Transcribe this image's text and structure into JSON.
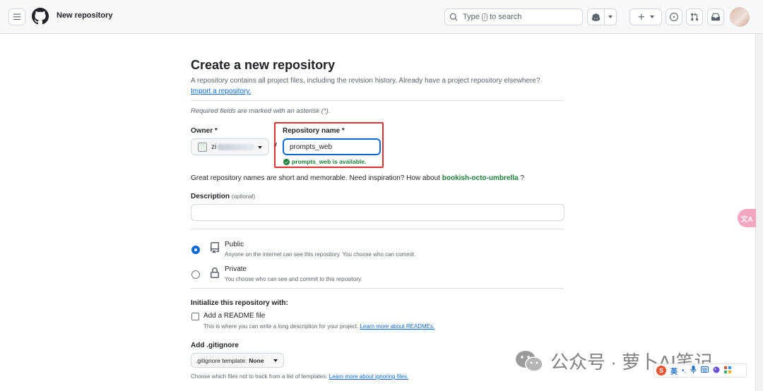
{
  "header": {
    "breadcrumb": "New repository",
    "search": {
      "prefix": "Type",
      "key": "/",
      "suffix": "to search"
    }
  },
  "page": {
    "title": "Create a new repository",
    "intro": "A repository contains all project files, including the revision history. Already have a project repository elsewhere?",
    "import_link": "Import a repository.",
    "required_note": "Required fields are marked with an asterisk (*).",
    "owner_label": "Owner *",
    "owner_value_visible": "zi",
    "separator": "/",
    "repo_name_label": "Repository name *",
    "repo_name_value": "prompts_web",
    "availability": "prompts_web is available.",
    "inspiration_text": "Great repository names are short and memorable. Need inspiration? How about",
    "suggestion": "bookish-octo-umbrella",
    "suggestion_tail": "?",
    "description_label": "Description",
    "description_optional": "(optional)",
    "visibility": {
      "selected": "Public",
      "public_title": "Public",
      "public_desc": "Anyone on the internet can see this repository. You choose who can commit.",
      "private_title": "Private",
      "private_desc": "You choose who can see and commit to this repository."
    },
    "init_heading": "Initialize this repository with:",
    "readme_label": "Add a README file",
    "readme_checked": false,
    "readme_desc": "This is where you can write a long description for your project.",
    "readme_link": "Learn more about READMEs.",
    "gitignore_heading": "Add .gitignore",
    "gitignore_prefix": ".gitignore template:",
    "gitignore_value": "None",
    "gitignore_desc": "Choose which files not to track from a list of templates.",
    "gitignore_link": "Learn more about ignoring files."
  },
  "overlays": {
    "translate_fab": "文A",
    "watermark": "公众号 · 萝卜AI笔记",
    "ime_lang": "英",
    "ime_brand": "S"
  },
  "colors": {
    "accent": "#0969da",
    "success": "#1a7f37",
    "highlight_box": "#e03131",
    "header_bg": "#f6f8fa"
  }
}
